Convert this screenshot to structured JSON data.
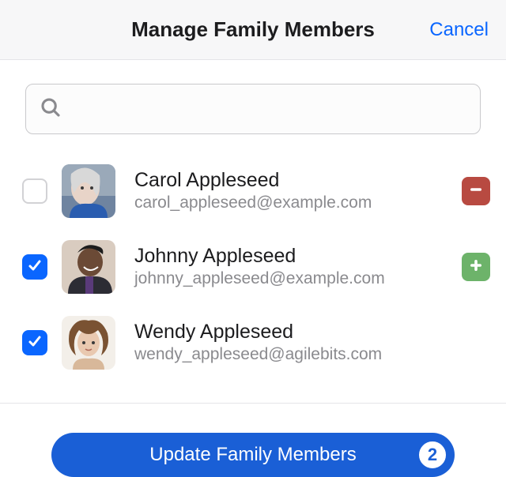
{
  "header": {
    "title": "Manage Family Members",
    "cancel": "Cancel"
  },
  "search": {
    "value": "",
    "placeholder": ""
  },
  "members": [
    {
      "name": "Carol Appleseed",
      "email": "carol_appleseed@example.com",
      "checked": false,
      "action": "remove"
    },
    {
      "name": "Johnny Appleseed",
      "email": "johnny_appleseed@example.com",
      "checked": true,
      "action": "add"
    },
    {
      "name": "Wendy Appleseed",
      "email": "wendy_appleseed@agilebits.com",
      "checked": true,
      "action": null
    }
  ],
  "footer": {
    "update_label": "Update Family Members",
    "count": "2"
  }
}
